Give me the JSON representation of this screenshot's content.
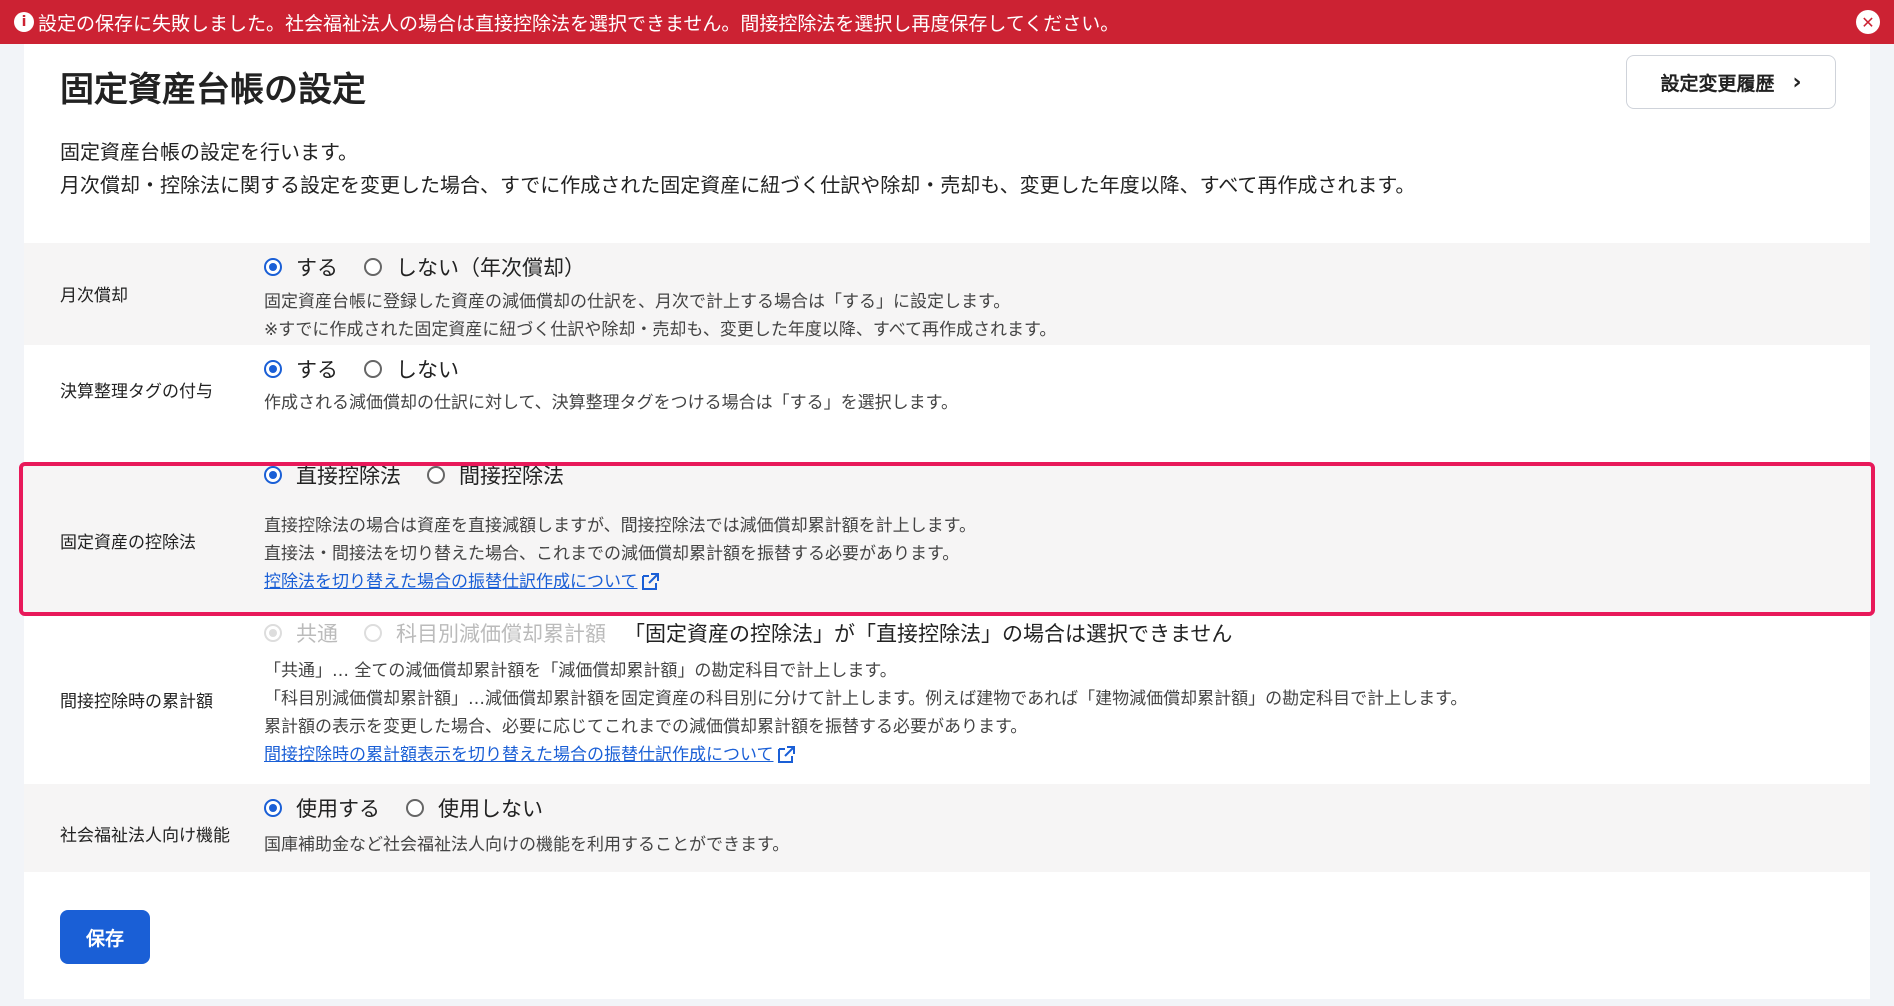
{
  "error_banner": {
    "message": "設定の保存に失敗しました。社会福祉法人の場合は直接控除法を選択できません。間接控除法を選択し再度保存してください。",
    "icon": "info-icon",
    "close_icon": "close-icon",
    "color": "#cc2233"
  },
  "header": {
    "title": "固定資産台帳の設定",
    "history_button": "設定変更履歴",
    "history_chevron": "›"
  },
  "description": {
    "line1": "固定資産台帳の設定を行います。",
    "line2": "月次償却・控除法に関する設定を変更した場合、すでに作成された固定資産に紐づく仕訳や除却・売却も、変更した年度以降、すべて再作成されます。"
  },
  "settings": {
    "monthly": {
      "label": "月次償却",
      "options": [
        "する",
        "しない（年次償却）"
      ],
      "selected": "する",
      "help1": "固定資産台帳に登録した資産の減価償却の仕訳を、月次で計上する場合は「する」に設定します。",
      "help2": "※すでに作成された固定資産に紐づく仕訳や除却・売却も、変更した年度以降、すべて再作成されます。"
    },
    "closing_tag": {
      "label": "決算整理タグの付与",
      "options": [
        "する",
        "しない"
      ],
      "selected": "する",
      "help1": "作成される減価償却の仕訳に対して、決算整理タグをつける場合は「する」を選択します。"
    },
    "deduction": {
      "label": "固定資産の控除法",
      "options": [
        "直接控除法",
        "間接控除法"
      ],
      "selected": "直接控除法",
      "help1": "直接控除法の場合は資産を直接減額しますが、間接控除法では減価償却累計額を計上します。",
      "help2": "直接法・間接法を切り替えた場合、これまでの減価償却累計額を振替する必要があります。",
      "link": "控除法を切り替えた場合の振替仕訳作成について"
    },
    "indirect_total": {
      "label": "間接控除時の累計額",
      "options": [
        "共通",
        "科目別減価償却累計額"
      ],
      "selected": "共通",
      "disabled_note": "「固定資産の控除法」が「直接控除法」の場合は選択できません",
      "help1": "「共通」… 全ての減価償却累計額を「減価償却累計額」の勘定科目で計上します。",
      "help2": "「科目別減価償却累計額」…減価償却累計額を固定資産の科目別に分けて計上します。例えば建物であれば「建物減価償却累計額」の勘定科目で計上します。",
      "help3": "累計額の表示を変更した場合、必要に応じてこれまでの減価償却累計額を振替する必要があります。",
      "link": "間接控除時の累計額表示を切り替えた場合の振替仕訳作成について"
    },
    "social_welfare": {
      "label": "社会福祉法人向け機能",
      "options": [
        "使用する",
        "使用しない"
      ],
      "selected": "使用する",
      "help1": "国庫補助金など社会福祉法人向けの機能を利用することができます。"
    }
  },
  "save_button": "保存",
  "colors": {
    "accent": "#1a5fd6",
    "highlight": "#e8195a",
    "row_gray": "#f6f5f5"
  }
}
